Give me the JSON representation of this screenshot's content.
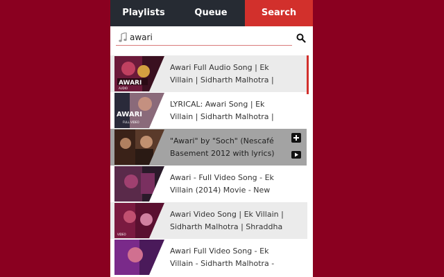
{
  "tabs": [
    {
      "label": "Playlists"
    },
    {
      "label": "Queue"
    },
    {
      "label": "Search"
    }
  ],
  "search": {
    "value": "awari",
    "placeholder": ""
  },
  "results": [
    {
      "title": "Awari Full Audio Song | Ek Villain | Sidharth Malhotra |",
      "thumb_text": "AWARI",
      "thumb_sub": "AUDIO"
    },
    {
      "title": "LYRICAL: Awari Song | Ek Villain | Sidharth Malhotra |",
      "thumb_text": "AWARI",
      "thumb_sub": "FULL VIDEO"
    },
    {
      "title": "\"Awari\" by \"Soch\" (Nescafé Basement 2012 with lyrics)",
      "thumb_text": "",
      "thumb_sub": ""
    },
    {
      "title": "Awari - Full Video Song - Ek Villain (2014) Movie - New",
      "thumb_text": "",
      "thumb_sub": ""
    },
    {
      "title": "Awari Video Song | Ek Villain | Sidharth Malhotra | Shraddha",
      "thumb_text": "",
      "thumb_sub": "VIDEO"
    },
    {
      "title": "Awari Full Video Song - Ek Villain - Sidharth Malhotra -",
      "thumb_text": "",
      "thumb_sub": ""
    }
  ],
  "colors": {
    "background": "#8a0020",
    "tab_dark": "#262b33",
    "tab_active": "#d2302c",
    "hover_row": "#a3a3a3",
    "alt_row": "#ebebeb"
  }
}
